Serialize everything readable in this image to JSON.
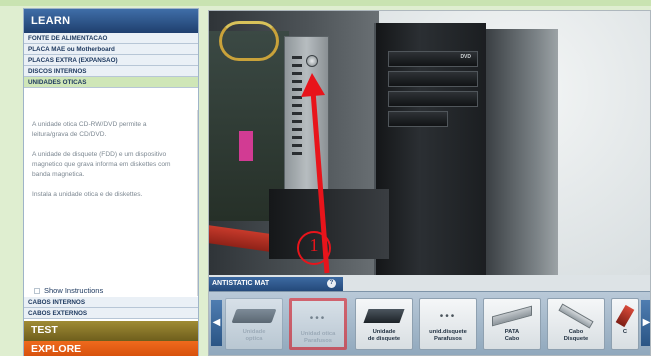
{
  "learn_header": "LEARN",
  "menu_top": [
    {
      "label": "FONTE DE ALIMENTACAO",
      "active": false
    },
    {
      "label": "PLACA MAE ou Motherboard",
      "active": false
    },
    {
      "label": "PLACAS EXTRA (EXPANSAO)",
      "active": false
    },
    {
      "label": "DISCOS INTERNOS",
      "active": false
    },
    {
      "label": "UNIDADES OTICAS",
      "active": true
    }
  ],
  "description": [
    "A unidade otica CD-RW/DVD permite a leitura/grava de CD/DVD.",
    "A unidade de disquete (FDD) e um dispositivo magnetico que grava informa em diskettes com banda magnetica.",
    "Instala a unidade otica e de diskettes."
  ],
  "show_instructions": "Show Instructions",
  "menu_bottom": [
    {
      "label": "CABOS INTERNOS"
    },
    {
      "label": "CABOS EXTERNOS"
    }
  ],
  "test_label": "TEST",
  "explore_label": "EXPLORE",
  "scene": {
    "dvd_logo": "DVD",
    "marker_number": "1"
  },
  "antistatic_label": "ANTISTATIC MAT",
  "help_glyph": "?",
  "tray_items": [
    {
      "line1": "Unidade",
      "line2": "optica",
      "icon": "optical-drive-icon",
      "state": "dim"
    },
    {
      "line1": "Unidad otica",
      "line2": "Parafusos",
      "icon": "screws-icon",
      "state": "selected"
    },
    {
      "line1": "Unidade",
      "line2": "de disquete",
      "icon": "floppy-drive-icon",
      "state": "normal"
    },
    {
      "line1": "unid.disquete",
      "line2": "Parafusos",
      "icon": "screws-icon",
      "state": "normal"
    },
    {
      "line1": "PATA",
      "line2": "Cabo",
      "icon": "pata-cable-icon",
      "state": "normal"
    },
    {
      "line1": "Cabo",
      "line2": "Disquete",
      "icon": "floppy-cable-icon",
      "state": "normal"
    },
    {
      "line1": "C",
      "line2": "",
      "icon": "cable-icon",
      "state": "partial"
    }
  ],
  "colors": {
    "highlight_red": "#e8141b",
    "learn_blue": "#2b558c",
    "test_olive": "#8a7a2a",
    "explore_orange": "#e35d14",
    "active_green": "#cfe6b7"
  }
}
